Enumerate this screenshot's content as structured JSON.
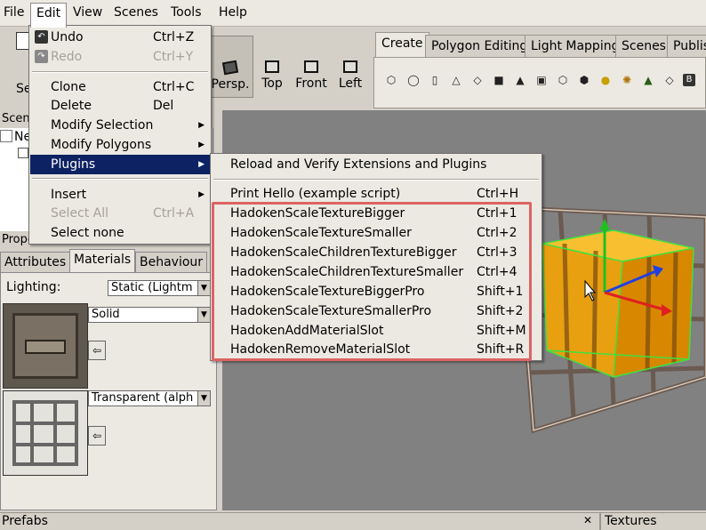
{
  "menubar": [
    "File",
    "Edit",
    "View",
    "Scenes",
    "Tools",
    "Help"
  ],
  "toolbar": {
    "left_partial_label": "Se",
    "view_buttons": [
      "Persp.",
      "Top",
      "Front",
      "Left"
    ]
  },
  "tabs": [
    "Create",
    "Polygon Editing",
    "Light Mapping",
    "Scenes",
    "Publis"
  ],
  "tool_icons": [
    "cube-icon",
    "sphere-icon",
    "cylinder-icon",
    "cone-icon",
    "plane-icon",
    "camera-icon",
    "terrain-icon",
    "billboard-icon",
    "mesh-icon",
    "box-icon",
    "light-icon",
    "particle-icon",
    "tree-icon",
    "water-icon",
    "b-icon"
  ],
  "left_panel": {
    "scene_header": "Scene",
    "tree_items": [
      "Ne"
    ],
    "properties_header": "Properties",
    "prop_tabs": [
      "Attributes",
      "Materials",
      "Behaviour"
    ],
    "lighting_label": "Lighting:",
    "lighting_value": "Static (Lightm",
    "material1_mode": "Solid",
    "material2_mode": "Transparent (alph"
  },
  "edit_menu": {
    "items": [
      {
        "label": "Undo",
        "shortcut": "Ctrl+Z",
        "enabled": true
      },
      {
        "label": "Redo",
        "shortcut": "Ctrl+Y",
        "enabled": false
      },
      {
        "label": "Clone",
        "shortcut": "Ctrl+C",
        "enabled": true
      },
      {
        "label": "Delete",
        "shortcut": "Del",
        "enabled": true
      },
      {
        "label": "Modify Selection",
        "shortcut": "",
        "enabled": true
      },
      {
        "label": "Modify Polygons",
        "shortcut": "",
        "enabled": true
      },
      {
        "label": "Plugins",
        "shortcut": "",
        "enabled": true
      },
      {
        "label": "Insert",
        "shortcut": "",
        "enabled": true
      },
      {
        "label": "Select All",
        "shortcut": "Ctrl+A",
        "enabled": false
      },
      {
        "label": "Select none",
        "shortcut": "",
        "enabled": true
      }
    ]
  },
  "plugins_menu": {
    "items": [
      {
        "label": "Reload and Verify Extensions and Plugins",
        "shortcut": ""
      },
      {
        "label": "Print Hello (example script)",
        "shortcut": "Ctrl+H"
      },
      {
        "label": "HadokenScaleTextureBigger",
        "shortcut": "Ctrl+1"
      },
      {
        "label": "HadokenScaleTextureSmaller",
        "shortcut": "Ctrl+2"
      },
      {
        "label": "HadokenScaleChildrenTextureBigger",
        "shortcut": "Ctrl+3"
      },
      {
        "label": "HadokenScaleChildrenTextureSmaller",
        "shortcut": "Ctrl+4"
      },
      {
        "label": "HadokenScaleTextureBiggerPro",
        "shortcut": "Shift+1"
      },
      {
        "label": "HadokenScaleTextureSmallerPro",
        "shortcut": "Shift+2"
      },
      {
        "label": "HadokenAddMaterialSlot",
        "shortcut": "Shift+M"
      },
      {
        "label": "HadokenRemoveMaterialSlot",
        "shortcut": "Shift+R"
      }
    ]
  },
  "bottom": {
    "prefabs_label": "Prefabs",
    "close_glyph": "✕",
    "textures_label": "Textures"
  },
  "colors": {
    "menu_highlight": "#0c2262",
    "annotation_box": "#dc6464",
    "viewport_bg": "#818181"
  }
}
